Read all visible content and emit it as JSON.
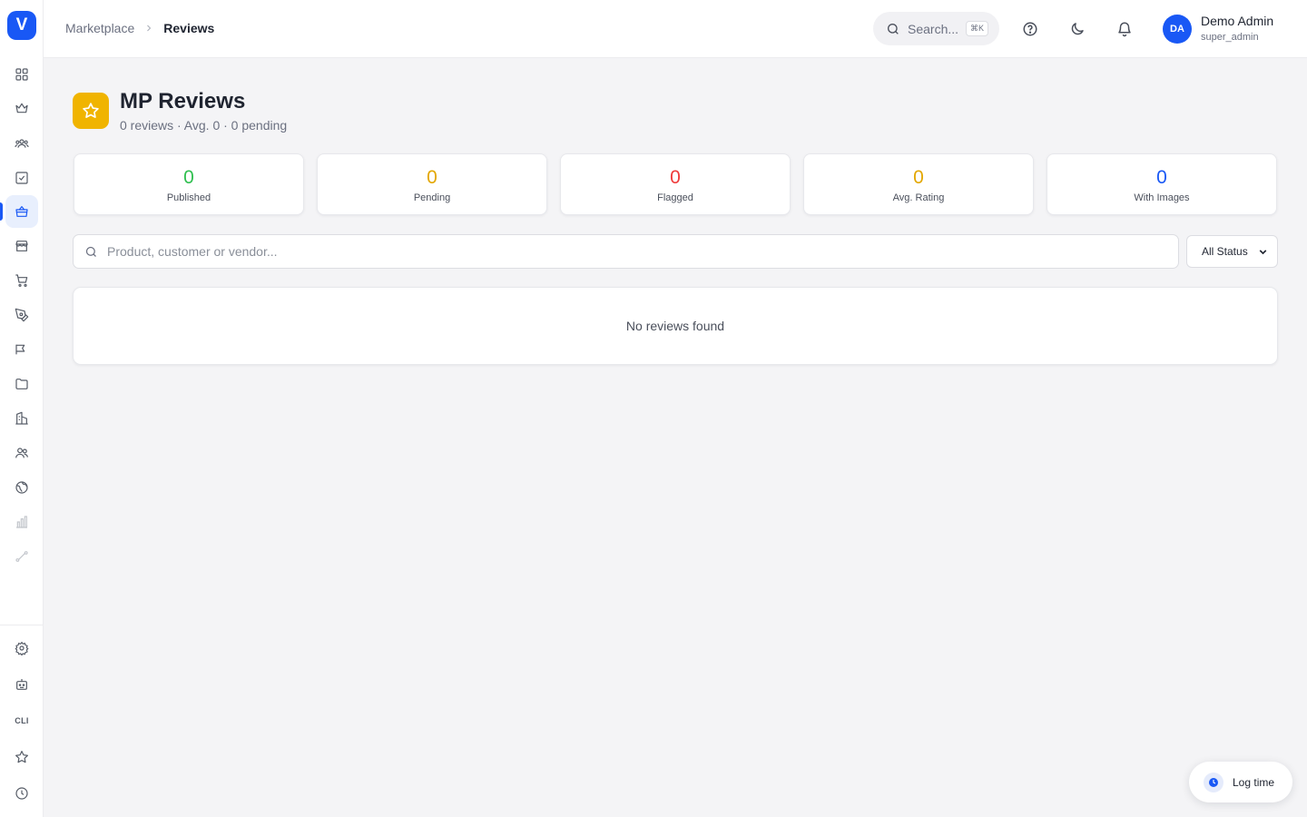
{
  "app": {
    "logo_letter": "V",
    "brand_color": "#1958f5"
  },
  "sidebar": {
    "items": [
      {
        "icon": "dashboard-icon"
      },
      {
        "icon": "crown-icon"
      },
      {
        "icon": "users-group-icon"
      },
      {
        "icon": "checkbox-icon"
      },
      {
        "icon": "marketplace-bag-icon",
        "active": true
      },
      {
        "icon": "store-icon"
      },
      {
        "icon": "cart-icon"
      },
      {
        "icon": "pen-tool-icon"
      },
      {
        "icon": "megaphone-icon"
      },
      {
        "icon": "folder-icon"
      },
      {
        "icon": "buildings-icon"
      },
      {
        "icon": "team-icon"
      },
      {
        "icon": "globe-icon"
      },
      {
        "icon": "bar-chart-icon",
        "disabled": true
      },
      {
        "icon": "route-icon",
        "disabled": true
      }
    ],
    "bottom": [
      {
        "icon": "settings-gear-icon"
      },
      {
        "icon": "bot-icon"
      },
      {
        "icon": "cli-icon",
        "label": "CLI"
      },
      {
        "icon": "star-icon"
      },
      {
        "icon": "clock-icon"
      }
    ]
  },
  "header": {
    "breadcrumb": {
      "parent": "Marketplace",
      "current": "Reviews"
    },
    "search": {
      "label": "Search...",
      "shortcut": "⌘K"
    },
    "user": {
      "initials": "DA",
      "name": "Demo Admin",
      "role": "super_admin"
    }
  },
  "page": {
    "title": "MP Reviews",
    "subtitle": "0 reviews · Avg. 0 · 0 pending",
    "icon": "star-icon",
    "icon_color": "#f0b400"
  },
  "stats": [
    {
      "value": "0",
      "label": "Published",
      "color": "#2fbf4f"
    },
    {
      "value": "0",
      "label": "Pending",
      "color": "#e3a700"
    },
    {
      "value": "0",
      "label": "Flagged",
      "color": "#ef3b3b"
    },
    {
      "value": "0",
      "label": "Avg. Rating",
      "color": "#e3a700"
    },
    {
      "value": "0",
      "label": "With Images",
      "color": "#1958f5"
    }
  ],
  "filters": {
    "search_placeholder": "Product, customer or vendor...",
    "status_selected": "All Status"
  },
  "empty_state": {
    "text": "No reviews found"
  },
  "log_time": {
    "label": "Log time"
  }
}
